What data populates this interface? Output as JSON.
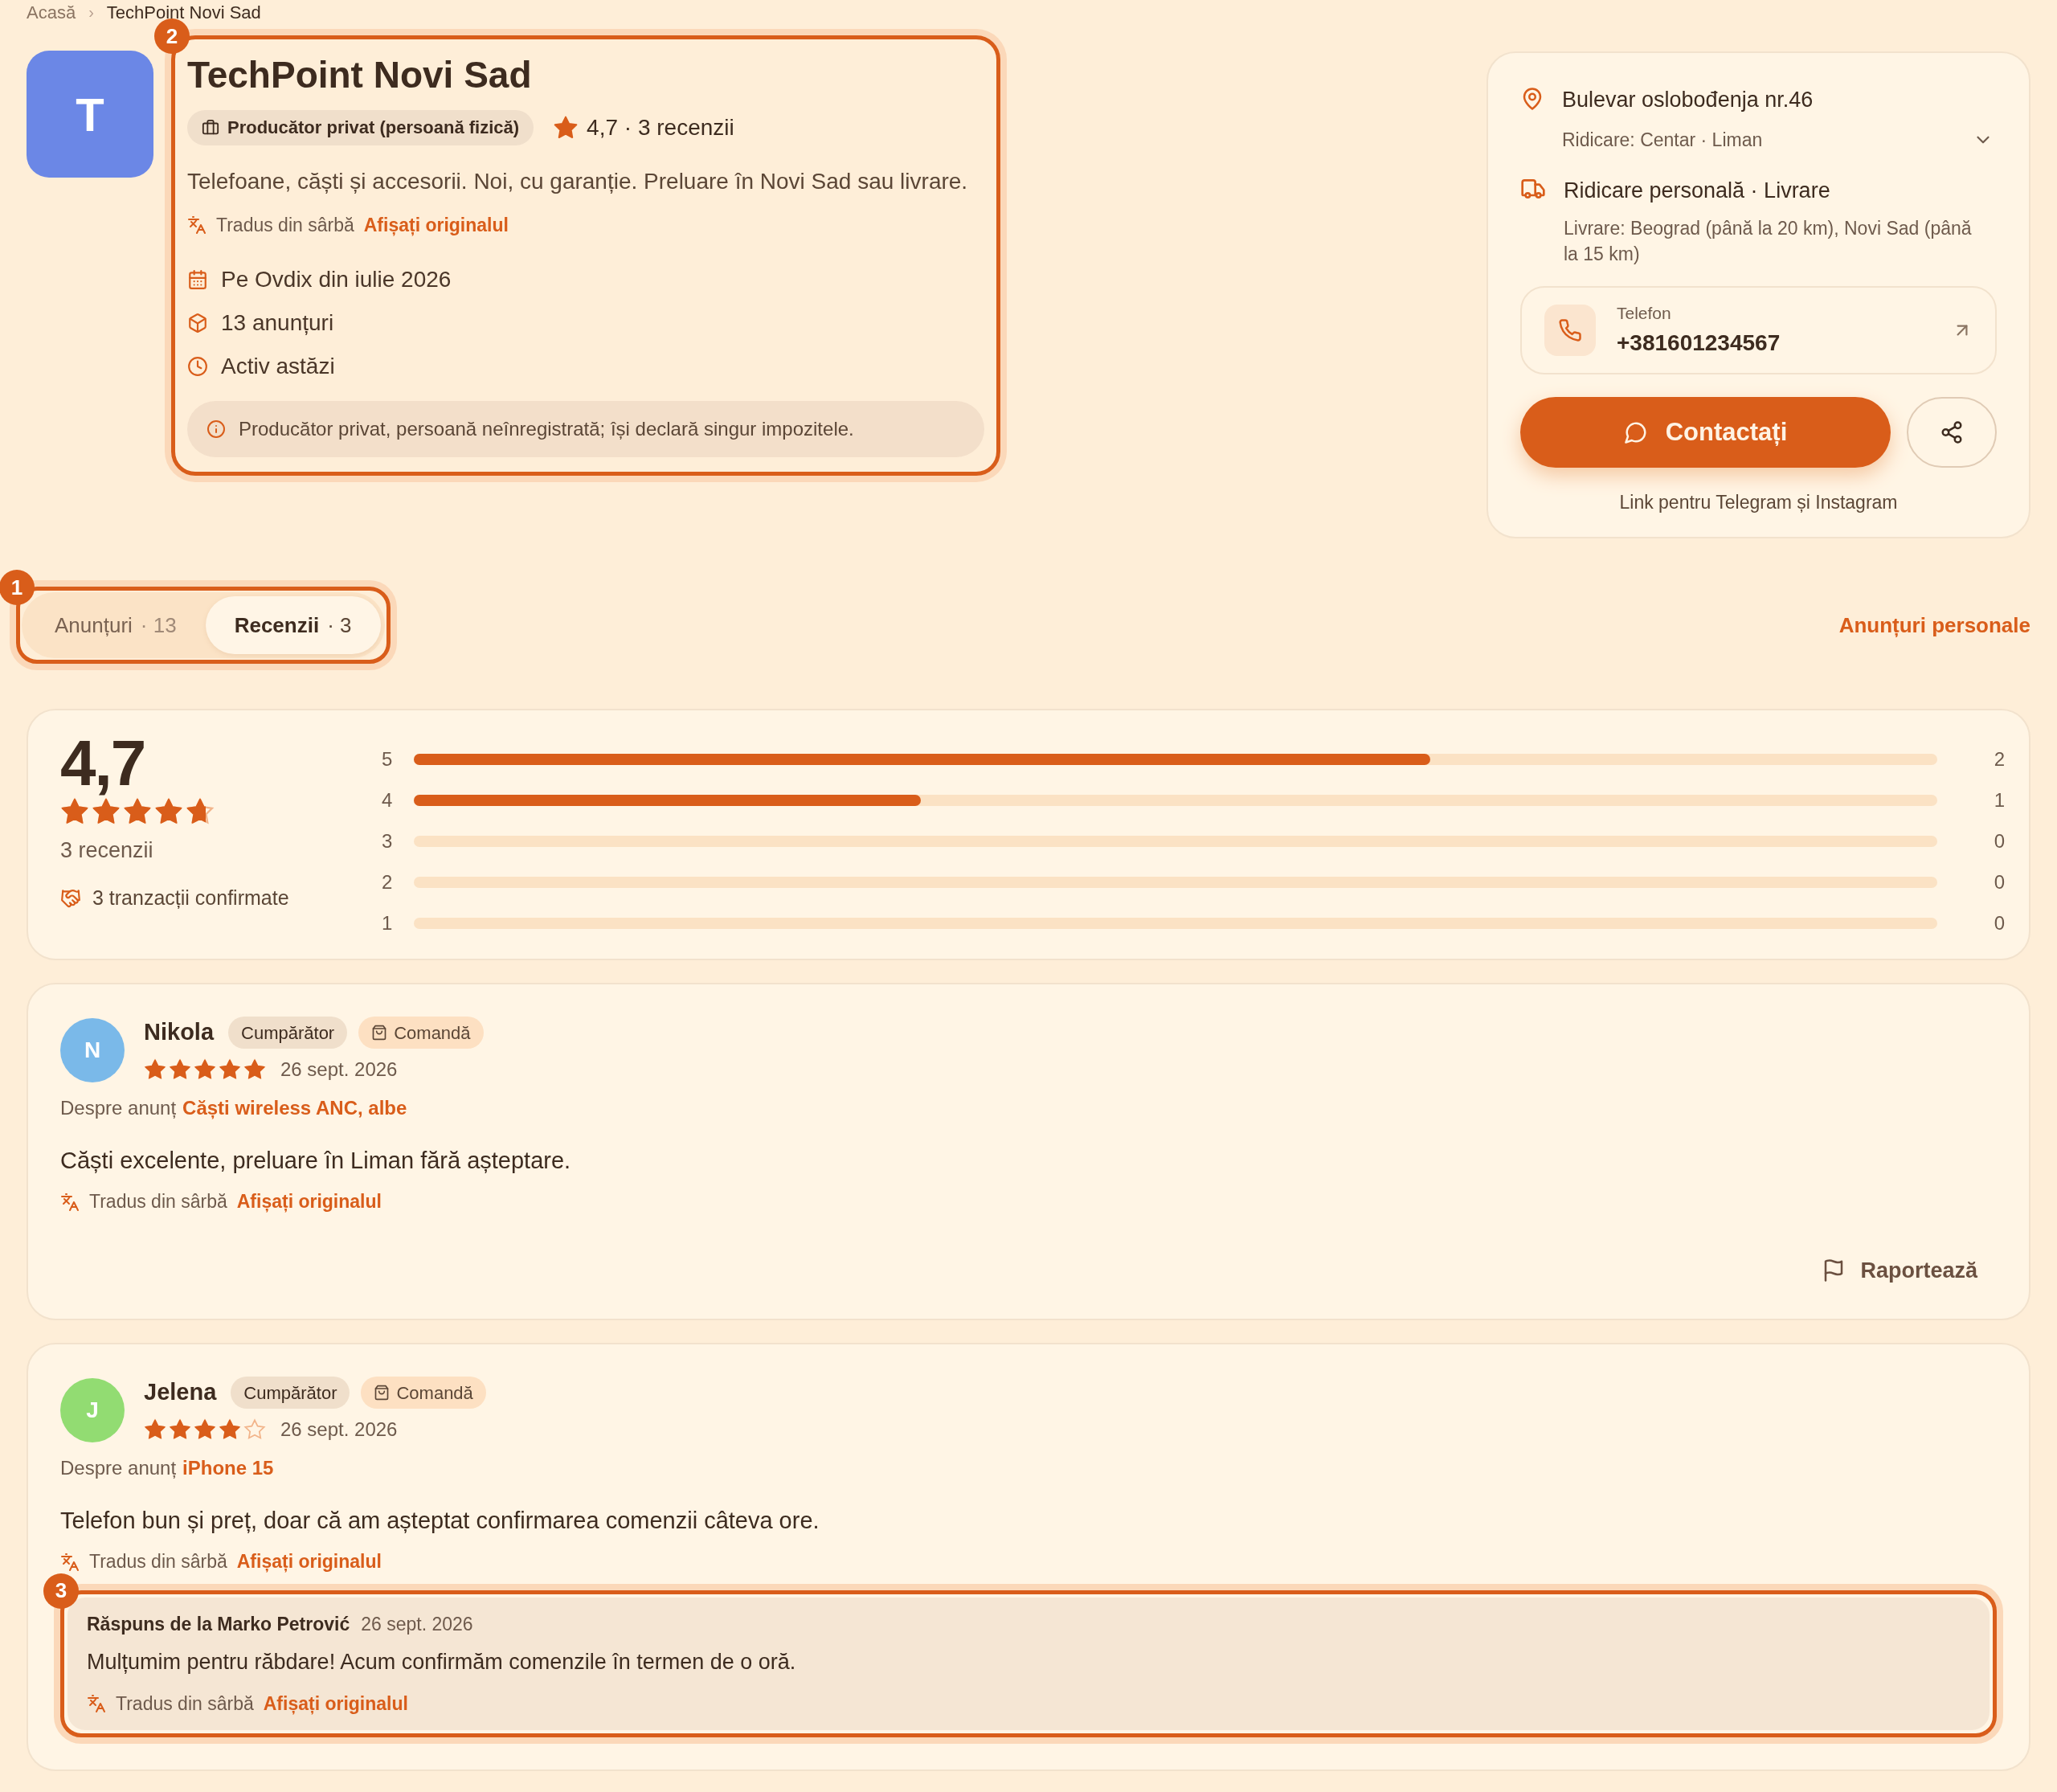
{
  "breadcrumb": [
    {
      "label": "Acasă"
    },
    {
      "label": "TechPoint Novi Sad"
    }
  ],
  "breadcrumb_separator": "›",
  "seller": {
    "avatar_letter": "T",
    "name": "TechPoint Novi Sad",
    "badge": "Producător privat (persoană fizică)",
    "rating_summary": "4,7 · 3 recenzii",
    "description": "Telefoane, căști și accesorii. Noi, cu garanție. Preluare în Novi Sad sau livrare.",
    "translation": {
      "note": "Tradus din sârbă",
      "link": "Afișați originalul"
    },
    "facts": [
      {
        "kind": "calendar",
        "text": "Pe Ovdix din iulie 2026"
      },
      {
        "kind": "package",
        "text": "13 anunțuri"
      },
      {
        "kind": "clock",
        "text": "Activ astăzi"
      }
    ],
    "notice": "Producător privat, persoană neînregistrată; își declară singur impozitele.",
    "highlight_label": "2"
  },
  "contact_card": {
    "address": "Bulevar oslobođenja nr.46",
    "pickup": "Ridicare: Centar · Liman",
    "expanded": false,
    "delivery_title": "Ridicare personală · Livrare",
    "delivery_detail": "Livrare: Beograd (până la 20 km), Novi Sad (până la 15 km)",
    "phone_label": "Telefon",
    "phone": "+381601234567",
    "contact_button": "Contactați",
    "links_note": "Link pentru Telegram și Instagram"
  },
  "tabs": {
    "highlight_label": "1",
    "items": [
      {
        "label": "Anunțuri",
        "count": "· 13",
        "selected": false
      },
      {
        "label": "Recenzii",
        "count": "· 3",
        "selected": true
      }
    ]
  },
  "personal_ads_link": "Anunțuri personale",
  "rating": {
    "score": "4,7",
    "stars": 4.7,
    "count": "3 recenzii",
    "confirmed": "3 tranzacții confirmate",
    "distribution": [
      {
        "star": "5",
        "level": 0.667,
        "count": "2"
      },
      {
        "star": "4",
        "level": 0.333,
        "count": "1"
      },
      {
        "star": "3",
        "level": 0,
        "count": "0"
      },
      {
        "star": "2",
        "level": 0,
        "count": "0"
      },
      {
        "star": "1",
        "level": 0,
        "count": "0"
      }
    ]
  },
  "reviews": [
    {
      "initial": "N",
      "color": "#7ab9e9",
      "name": "Nikola",
      "role": "Cumpărător",
      "tag": "Comandă",
      "stars": 5,
      "date": "26 sept. 2026",
      "about": "Despre anunț",
      "listing": "Căști wireless ANC, albe",
      "text": "Căști excelente, preluare în Liman fără așteptare.",
      "translation": {
        "note": "Tradus din sârbă",
        "link": "Afișați originalul"
      },
      "report": "Raportează"
    },
    {
      "initial": "J",
      "color": "#92dc72",
      "name": "Jelena",
      "role": "Cumpărător",
      "tag": "Comandă",
      "stars": 4,
      "date": "26 sept. 2026",
      "about": "Despre anunț",
      "listing": "iPhone 15",
      "text": "Telefon bun și preț, doar că am așteptat confirmarea comenzii câteva ore.",
      "translation": {
        "note": "Tradus din sârbă",
        "link": "Afișați originalul"
      },
      "reply": {
        "author": "Răspuns de la Marko Petrović",
        "date": "26 sept. 2026",
        "text": "Mulțumim pentru răbdare! Acum confirmăm comenzile în termen de o oră.",
        "translation": {
          "note": "Tradus din sârbă",
          "link": "Afișați originalul"
        },
        "highlight_label": "3"
      }
    }
  ]
}
